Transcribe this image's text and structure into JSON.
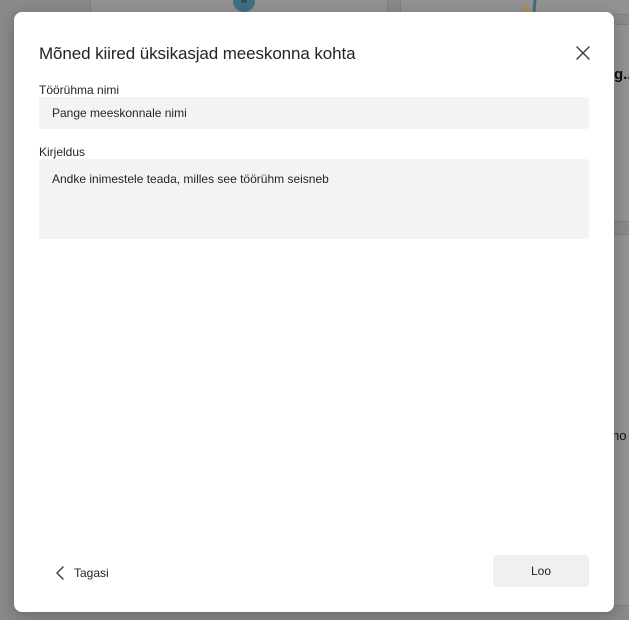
{
  "background": {
    "partial_text_1": "g..",
    "partial_text_2": "ho"
  },
  "dialog": {
    "title": "Mõned kiired üksikasjad meeskonna kohta",
    "close_icon": "close-icon",
    "fields": {
      "name": {
        "label": "Töörühma nimi",
        "placeholder": "Pange meeskonnale nimi",
        "value": ""
      },
      "description": {
        "label": "Kirjeldus",
        "placeholder": "Andke inimestele teada, milles see töörühm seisneb",
        "value": ""
      }
    },
    "footer": {
      "back_label": "Tagasi",
      "back_icon": "chevron-left-icon",
      "create_label": "Loo"
    }
  }
}
